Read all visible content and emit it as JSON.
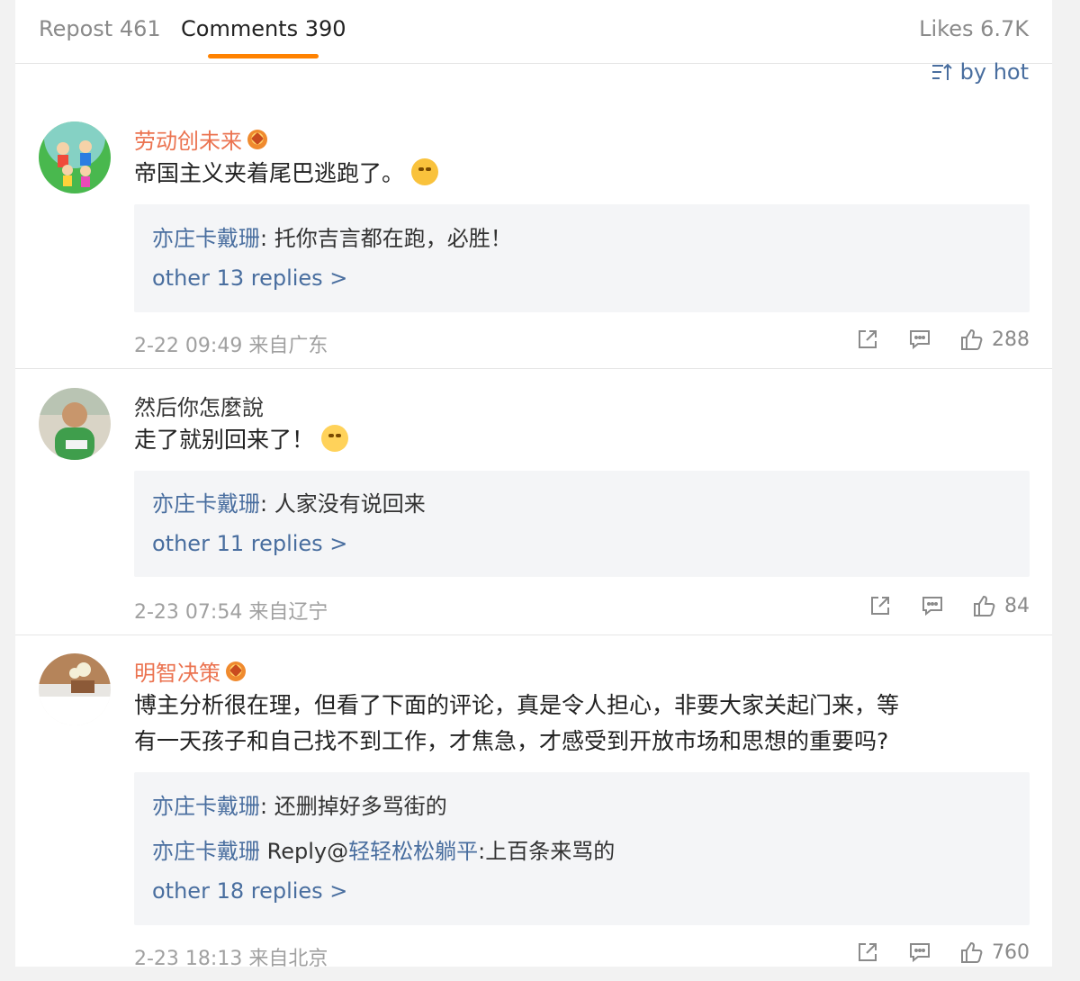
{
  "tabs": {
    "repost": "Repost 461",
    "comments": "Comments 390",
    "likes": "Likes 6.7K"
  },
  "sort_label": "by hot",
  "colors": {
    "accent": "#ff8200",
    "link": "#496e9f",
    "username": "#eb7350"
  },
  "comments": [
    {
      "user": "劳动创未来",
      "text": "帝国主义夹着尾巴逃跑了。",
      "replies": [
        {
          "who": "亦庄卡戴珊",
          "text": ": 托你吉言都在跑，必胜！"
        }
      ],
      "more": "other 13 replies >",
      "meta": "2-22 09:49 来自广东",
      "likes": "288"
    },
    {
      "user": "然后你怎麼說",
      "text": "走了就别回来了！",
      "replies": [
        {
          "who": "亦庄卡戴珊",
          "text": ": 人家没有说回来"
        }
      ],
      "more": "other 11 replies >",
      "meta": "2-23 07:54 来自辽宁",
      "likes": "84"
    },
    {
      "user": "明智决策",
      "text_line1": "博主分析很在理，但看了下面的评论，真是令人担心，非要大家关起门来，等",
      "text_line2": "有一天孩子和自己找不到工作，才焦急，才感受到开放市场和思想的重要吗?",
      "replies": [
        {
          "who": "亦庄卡戴珊",
          "text": ": 还删掉好多骂街的"
        },
        {
          "who": "亦庄卡戴珊",
          "mid": " Reply@",
          "who2": "轻轻松松躺平",
          "text": ":上百条来骂的"
        }
      ],
      "more": "other 18 replies >",
      "meta": "2-23 18:13 来自北京",
      "likes": "760"
    }
  ]
}
